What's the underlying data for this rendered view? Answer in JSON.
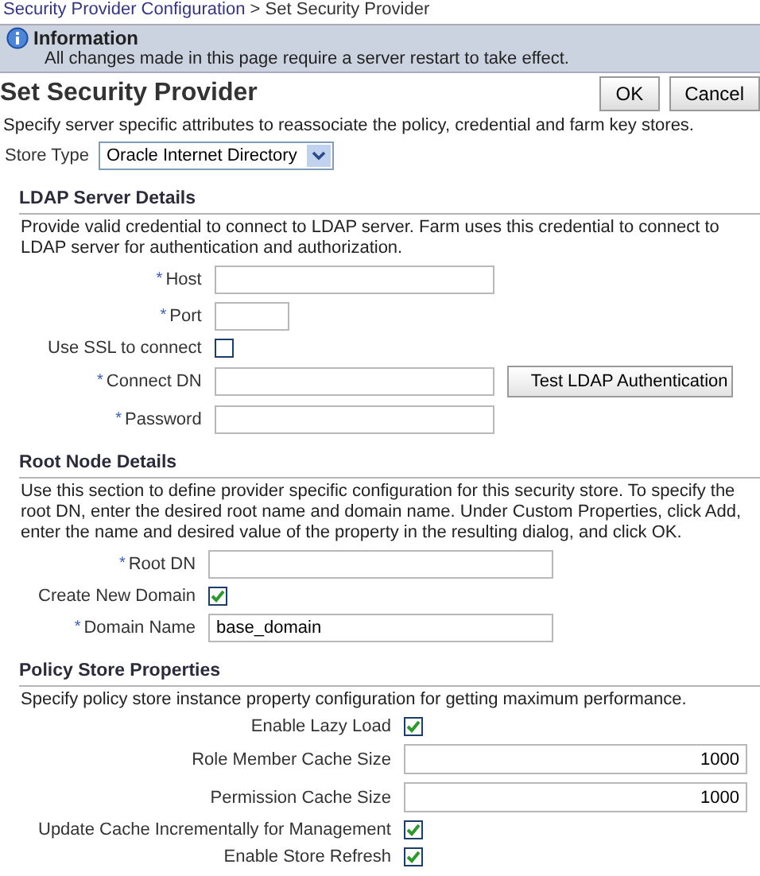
{
  "breadcrumb": {
    "link": "Security Provider Configuration",
    "separator": ">",
    "current": "Set Security Provider"
  },
  "info": {
    "title": "Information",
    "message": "All changes made in this page require a server restart to take effect."
  },
  "page": {
    "title": "Set Security Provider",
    "buttons": [
      "OK",
      "Cancel"
    ],
    "description": "Specify server specific attributes to reassociate the policy, credential and farm key stores.",
    "store_type": {
      "label": "Store Type",
      "value": "Oracle Internet Directory"
    }
  },
  "sections": [
    {
      "title": "LDAP Server Details",
      "description": "Provide valid credential to connect to LDAP server. Farm uses this credential to connect to LDAP server for authentication and authorization.",
      "fields": [
        {
          "kind": "text",
          "marker": "*",
          "label": "Host"
        },
        {
          "kind": "short",
          "marker": "*",
          "label": "Port"
        },
        {
          "kind": "checkbox",
          "label": "Use SSL to connect",
          "checked": false
        },
        {
          "kind": "text",
          "marker": "*",
          "label": "Connect DN",
          "button": "Test LDAP Authentication"
        },
        {
          "kind": "text",
          "marker": "*",
          "label": "Password"
        }
      ]
    },
    {
      "title": "Root Node Details",
      "description": "Use this section to define provider specific configuration for this security store. To specify the root DN, enter the desired root name and domain name. Under Custom Properties, click Add, enter the name and desired value of the property in the resulting dialog, and click OK.",
      "fields": [
        {
          "kind": "text",
          "marker": "*",
          "label": "Root DN"
        },
        {
          "kind": "checkbox",
          "label": "Create New Domain",
          "checked": true
        },
        {
          "kind": "text",
          "marker": "*",
          "label": "Domain Name",
          "value": "base_domain"
        }
      ]
    },
    {
      "title": "Policy Store Properties",
      "description": "Specify policy store instance property configuration for getting maximum performance.",
      "fields": [
        {
          "kind": "checkbox",
          "label": "Enable Lazy Load",
          "checked": true
        },
        {
          "kind": "number",
          "label": "Role Member Cache Size",
          "value": "1000"
        },
        {
          "kind": "number",
          "label": "Permission Cache Size",
          "value": "1000"
        },
        {
          "kind": "checkbox",
          "label": "Update Cache Incrementally for Management",
          "checked": true
        },
        {
          "kind": "checkbox",
          "label": "Enable Store Refresh",
          "checked": true
        }
      ]
    }
  ]
}
